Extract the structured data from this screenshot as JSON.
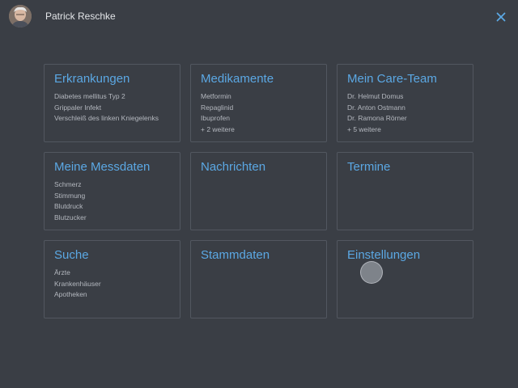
{
  "header": {
    "user_name": "Patrick Reschke"
  },
  "icons": {
    "avatar": "user-avatar",
    "close": "close-icon"
  },
  "colors": {
    "background": "#3a3e45",
    "accent": "#5ba8e4",
    "tile_border": "#525760",
    "text_secondary": "#b4b8bf"
  },
  "tiles": [
    {
      "title": "Erkrankungen",
      "lines": [
        "Diabetes mellitus Typ 2",
        "Grippaler Infekt",
        "Verschleiß des linken Kniegelenks"
      ]
    },
    {
      "title": "Medikamente",
      "lines": [
        "Metformin",
        "Repaglinid",
        "Ibuprofen",
        "+ 2 weitere"
      ]
    },
    {
      "title": "Mein Care-Team",
      "lines": [
        "Dr. Helmut Domus",
        "Dr. Anton Ostmann",
        "Dr. Ramona Rörner",
        "+ 5 weitere"
      ]
    },
    {
      "title": "Meine Messdaten",
      "lines": [
        "Schmerz",
        "Stimmung",
        "Blutdruck",
        "Blutzucker"
      ]
    },
    {
      "title": "Nachrichten",
      "lines": []
    },
    {
      "title": "Termine",
      "lines": []
    },
    {
      "title": "Suche",
      "lines": [
        "Ärzte",
        "Krankenhäuser",
        "Apotheken"
      ]
    },
    {
      "title": "Stammdaten",
      "lines": []
    },
    {
      "title": "Einstellungen",
      "lines": []
    }
  ]
}
